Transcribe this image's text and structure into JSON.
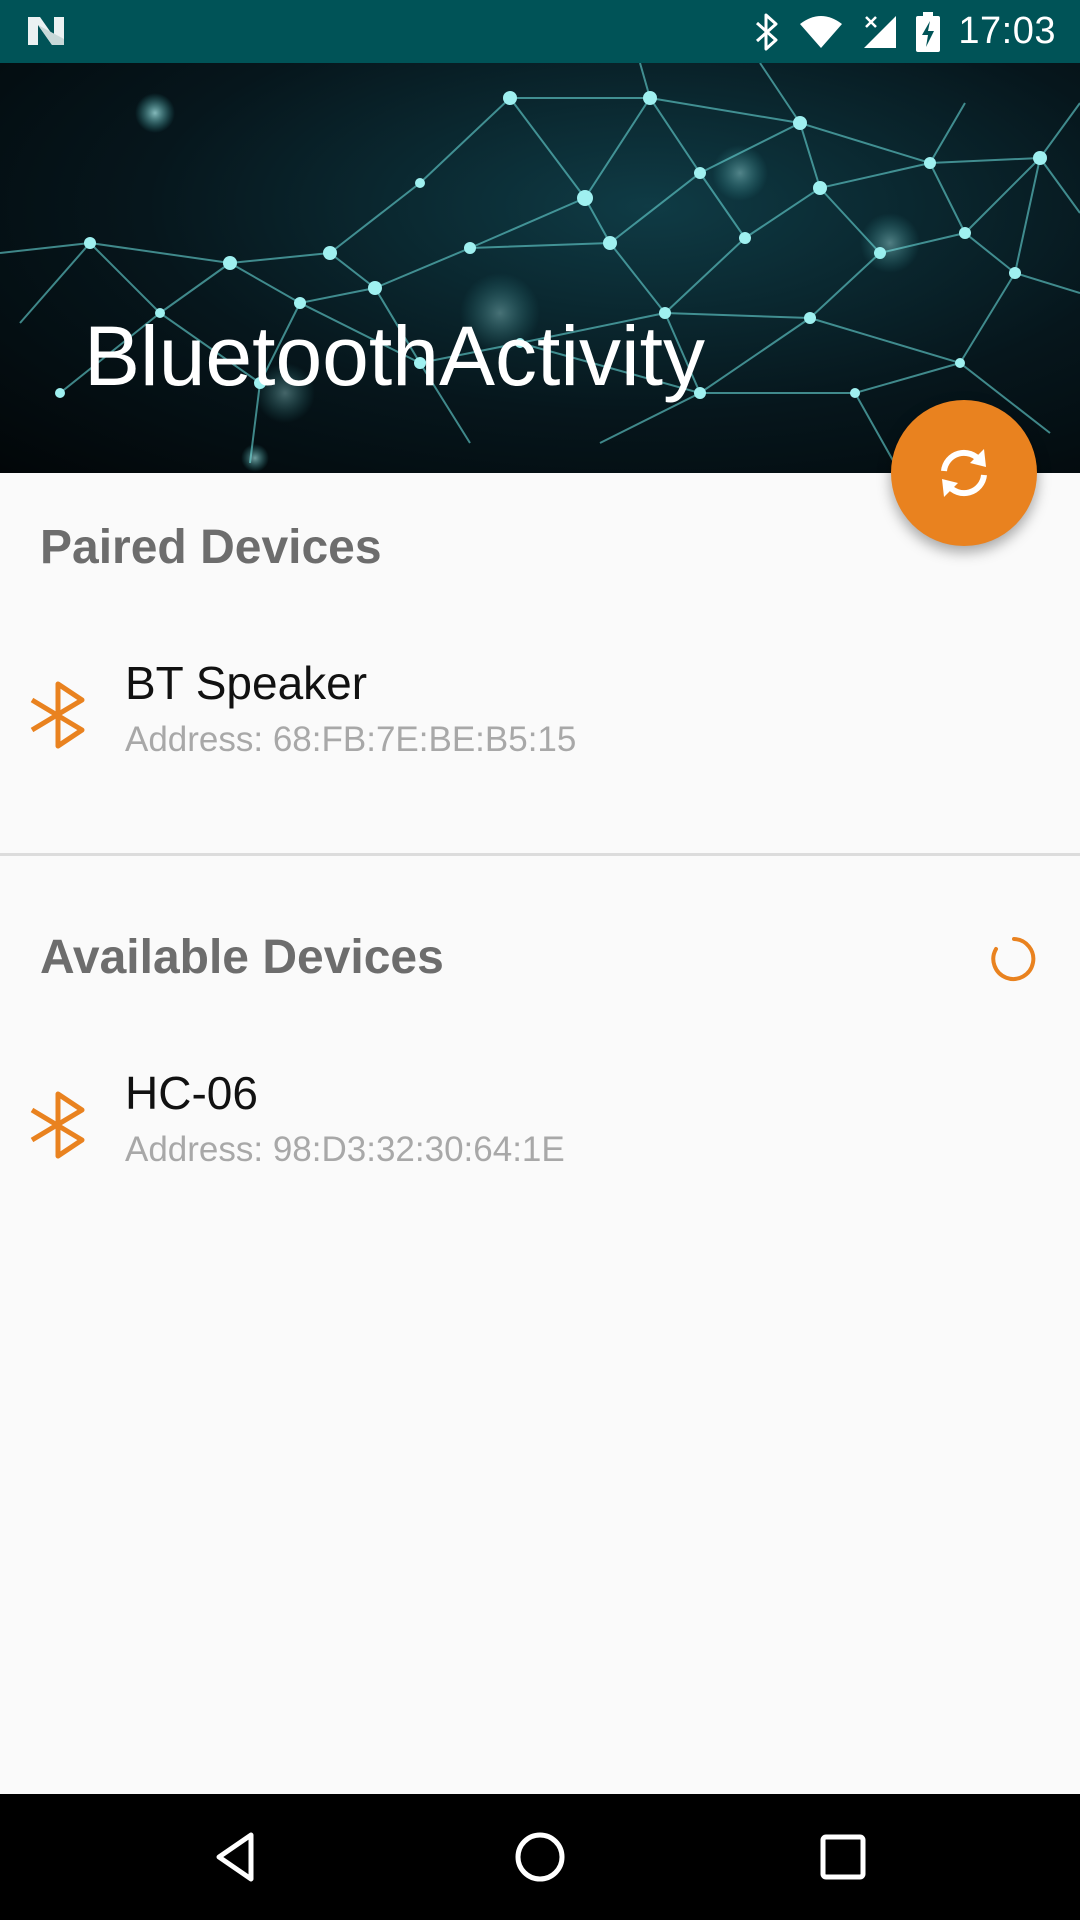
{
  "status_bar": {
    "time": "17:03",
    "icons": [
      "android-n-icon",
      "bluetooth-icon",
      "wifi-icon",
      "signal-icon",
      "battery-icon"
    ]
  },
  "header": {
    "title": "BluetoothActivity"
  },
  "fab": {
    "icon": "refresh-icon",
    "color": "#e9821f"
  },
  "paired": {
    "title": "Paired Devices",
    "devices": [
      {
        "name": "BT Speaker",
        "address": "Address: 68:FB:7E:BE:B5:15"
      }
    ]
  },
  "available": {
    "title": "Available Devices",
    "devices": [
      {
        "name": "HC-06",
        "address": "Address: 98:D3:32:30:64:1E"
      }
    ]
  },
  "colors": {
    "accent": "#e9821f",
    "status_bar": "#005357"
  },
  "nav_bar": {
    "buttons": [
      "back-icon",
      "home-icon",
      "recents-icon"
    ]
  }
}
